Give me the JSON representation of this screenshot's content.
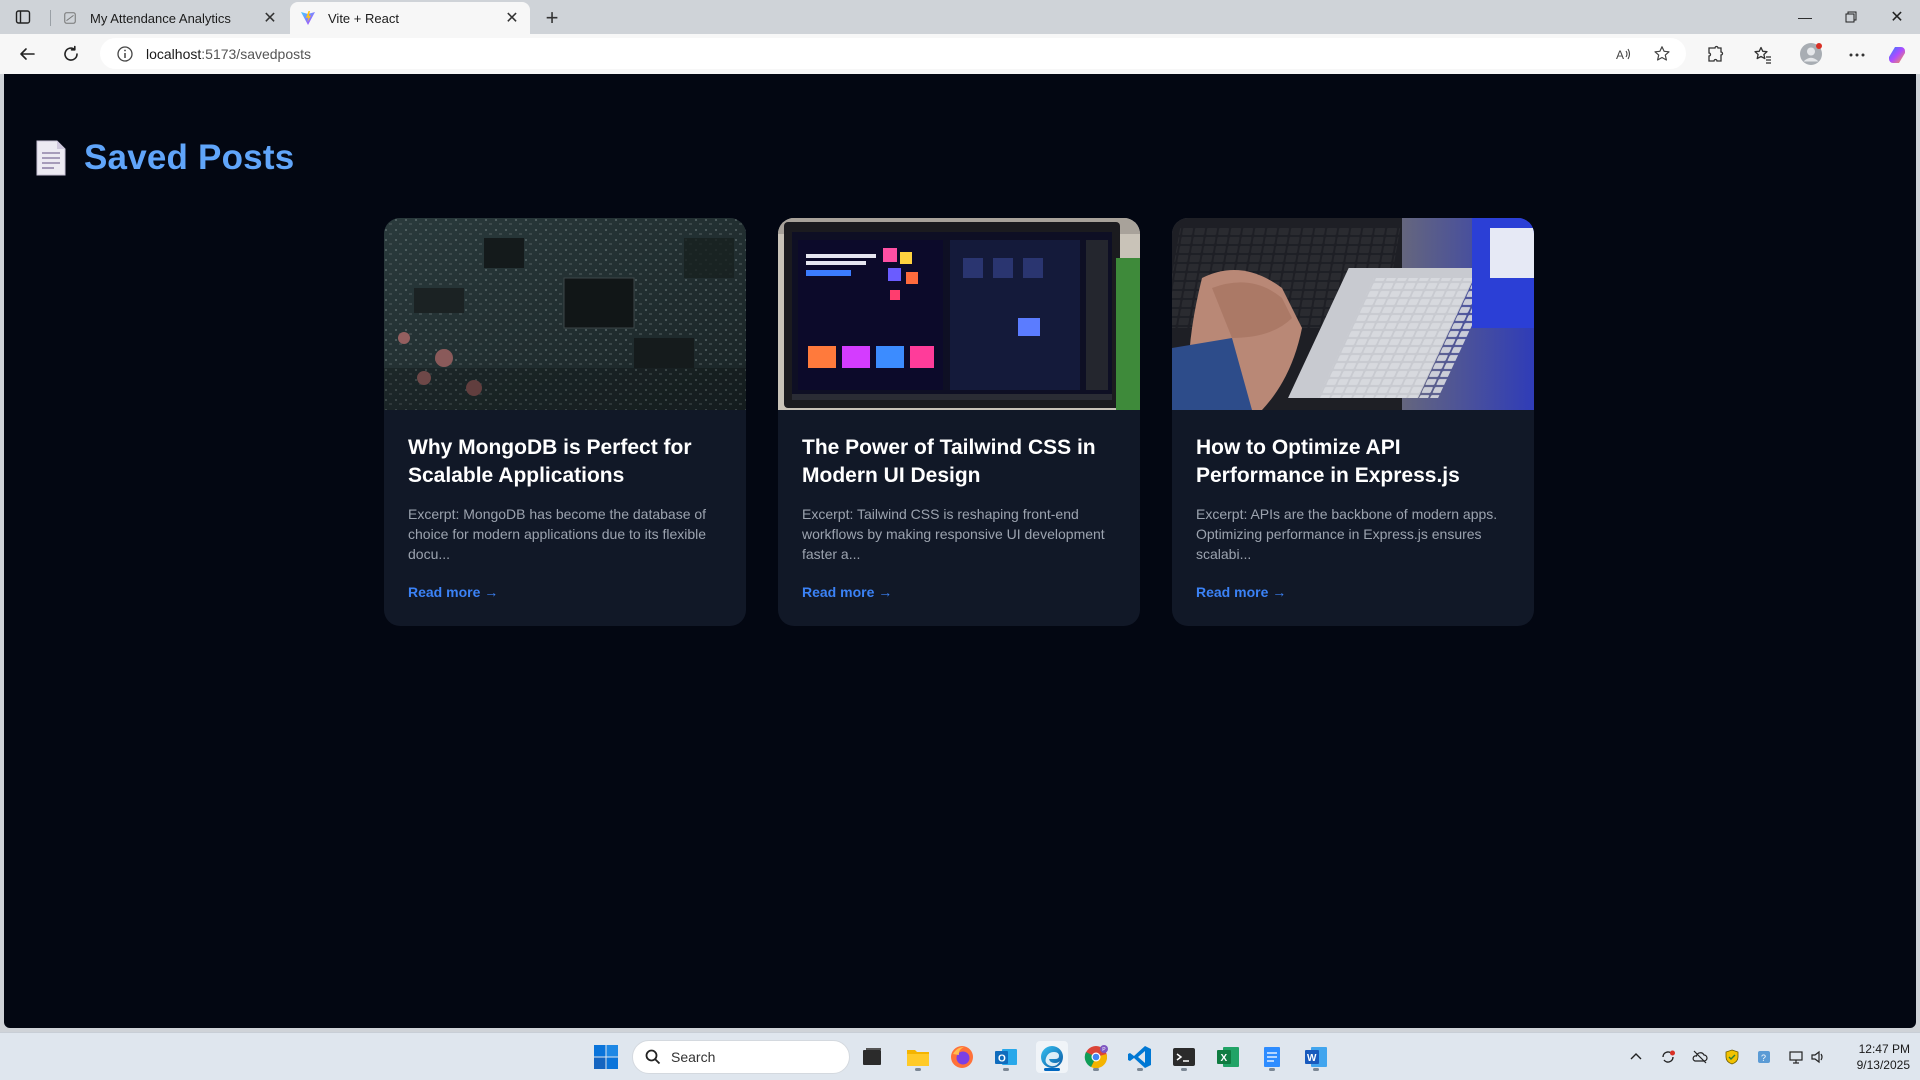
{
  "browser": {
    "tabs": [
      {
        "title": "My Attendance Analytics",
        "active": false
      },
      {
        "title": "Vite + React",
        "active": true
      }
    ],
    "address": {
      "host": "localhost",
      "path": ":5173/savedposts"
    }
  },
  "page": {
    "title": "Saved Posts",
    "posts": [
      {
        "title": "Why MongoDB is Perfect for Scalable Applications",
        "excerpt": "Excerpt: MongoDB has become the database of choice for modern applications due to its flexible docu...",
        "link": "Read more →",
        "image": "circuit-board-photo"
      },
      {
        "title": "The Power of Tailwind CSS in Modern UI Design",
        "excerpt": "Excerpt: Tailwind CSS is reshaping front-end workflows by making responsive UI development faster a...",
        "link": "Read more →",
        "image": "design-monitor-photo"
      },
      {
        "title": "How to Optimize API Performance in Express.js",
        "excerpt": "Excerpt: APIs are the backbone of modern apps. Optimizing performance in Express.js ensures scalabi...",
        "link": "Read more →",
        "image": "laptop-typing-photo"
      }
    ]
  },
  "taskbar": {
    "search_placeholder": "Search",
    "time": "12:47 PM",
    "date": "9/13/2025"
  },
  "colors": {
    "page_bg": "#030712",
    "card_bg": "#111827",
    "title_accent": "#60a5fa",
    "link": "#3b82f6"
  }
}
